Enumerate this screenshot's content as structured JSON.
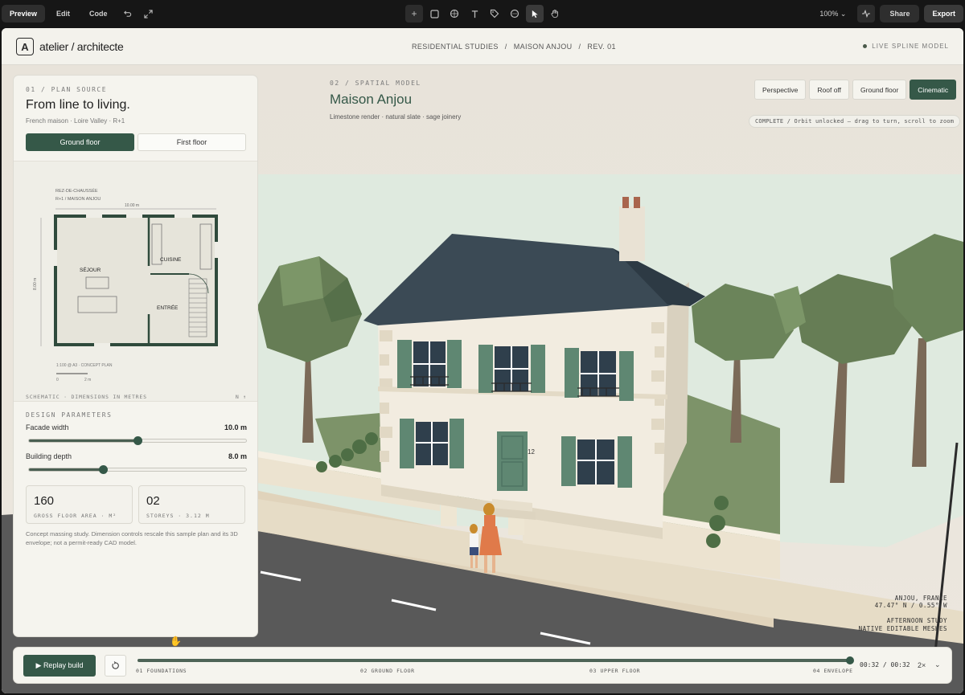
{
  "editor": {
    "modes": [
      "Preview",
      "Edit",
      "Code"
    ],
    "active_mode": "Preview",
    "zoom": "100%",
    "share_label": "Share",
    "export_label": "Export",
    "tool_icons": [
      "plus-icon",
      "square-icon",
      "component-icon",
      "text-icon",
      "tag-icon",
      "comment-icon",
      "pointer-icon",
      "hand-icon"
    ]
  },
  "site": {
    "logo_letter": "A",
    "brand": "atelier / architecte",
    "breadcrumb": [
      "RESIDENTIAL STUDIES",
      "/",
      "MAISON ANJOU",
      "/",
      "REV. 01"
    ],
    "live_label": "LIVE SPLINE MODEL"
  },
  "panel": {
    "eyebrow": "01 / PLAN SOURCE",
    "title": "From line to living.",
    "subtitle": "French maison · Loire Valley · R+1",
    "floors": [
      "Ground floor",
      "First floor"
    ],
    "active_floor": "Ground floor",
    "plan": {
      "header_1": "REZ-DE-CHAUSSÉE",
      "header_2": "R+1 / MAISON ANJOU",
      "width_dim": "10.00 m",
      "depth_dim": "8.00 m",
      "rooms": [
        "SÉJOUR",
        "CUISINE",
        "ENTRÉE"
      ],
      "scale_note": "1:100 @ A3 · CONCEPT PLAN",
      "scale_0": "0",
      "scale_2": "2 m"
    },
    "plan_footer_left": "SCHEMATIC · DIMENSIONS IN METRES",
    "plan_footer_right": "N ↑",
    "params_eyebrow": "DESIGN PARAMETERS",
    "params": [
      {
        "label": "Facade width",
        "value": "10.0 m",
        "fraction": 0.5
      },
      {
        "label": "Building depth",
        "value": "8.0 m",
        "fraction": 0.34
      }
    ],
    "stats": [
      {
        "num": "160",
        "label": "GROSS FLOOR AREA · M²"
      },
      {
        "num": "02",
        "label": "STOREYS · 3.12 M"
      }
    ],
    "note": "Concept massing study. Dimension controls rescale this sample plan and its 3D envelope; not a permit-ready CAD model."
  },
  "model": {
    "eyebrow": "02 / SPATIAL MODEL",
    "title": "Maison Anjou",
    "subtitle": "Limestone render · natural slate · sage joinery",
    "views": [
      "Perspective",
      "Roof off",
      "Ground floor",
      "Cinematic"
    ],
    "active_view": "Cinematic",
    "status": "COMPLETE / Orbit unlocked — drag to turn, scroll to zoom",
    "house_number": "12",
    "coords": [
      "ANJOU, FRANCE",
      "47.47° N / 0.55° W",
      "",
      "AFTERNOON STUDY",
      "NATIVE EDITABLE MESHES"
    ]
  },
  "timeline": {
    "replay_label": "▶ Replay build",
    "progress": 1.0,
    "phases": [
      "01 FOUNDATIONS",
      "02 GROUND FLOOR",
      "03 UPPER FLOOR",
      "04 ENVELOPE"
    ],
    "time": "00:32 / 00:32",
    "speed": "2×"
  },
  "colors": {
    "accent": "#355848",
    "canvas": "#eceae3",
    "grass": "#7d9369",
    "road": "#595959",
    "shutter": "#5f8772",
    "roof": "#3b4a55"
  }
}
